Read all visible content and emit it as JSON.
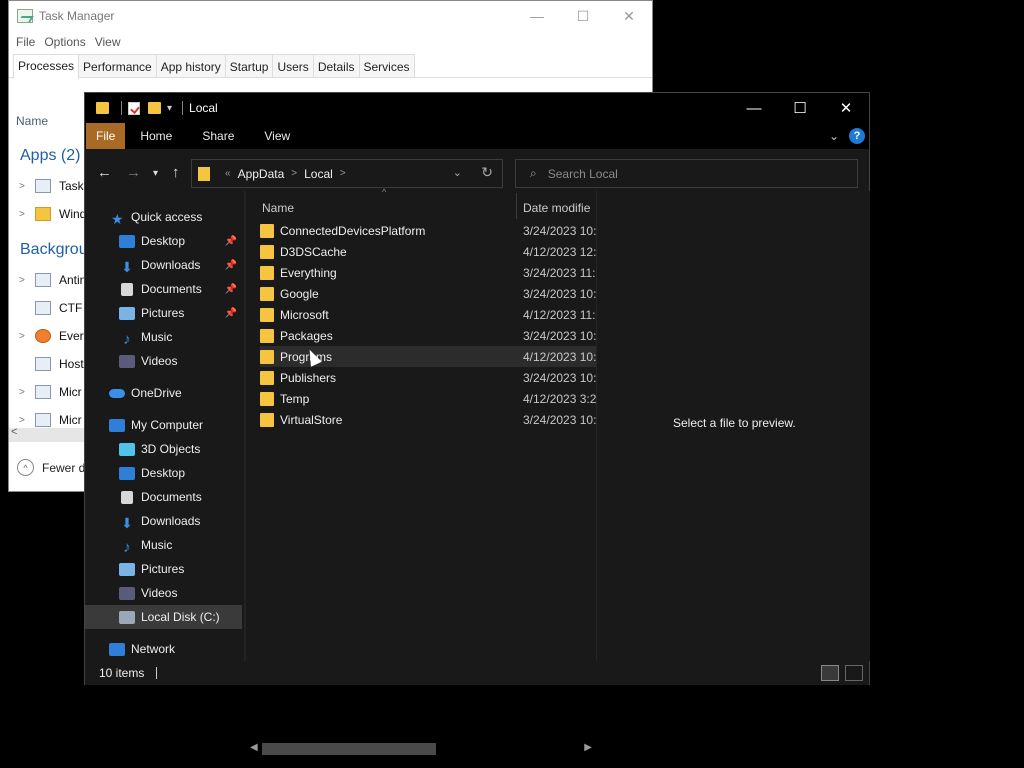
{
  "task_manager": {
    "title": "Task Manager",
    "caption_buttons": [
      "—",
      "☐",
      "✕"
    ],
    "menu": [
      "File",
      "Options",
      "View"
    ],
    "tabs": [
      "Processes",
      "Performance",
      "App history",
      "Startup",
      "Users",
      "Details",
      "Services"
    ],
    "active_tab": "Processes",
    "column_name": "Name",
    "group_apps": "Apps (2)",
    "group_background": "Backgrou",
    "rows": [
      "Task",
      "Wind",
      "Antin",
      "CTF",
      "Every",
      "Host",
      "Micr",
      "Micr"
    ],
    "fewer_details": "Fewer d"
  },
  "explorer": {
    "title": "Local",
    "caption_buttons": [
      "—",
      "☐",
      "✕"
    ],
    "ribbon_tabs": [
      "File",
      "Home",
      "Share",
      "View"
    ],
    "help_label": "?",
    "address": {
      "overflow": "«",
      "segments": [
        "AppData",
        "Local"
      ]
    },
    "search_placeholder": "Search Local",
    "nav_pane": {
      "quick_access": "Quick access",
      "quick_items": [
        "Desktop",
        "Downloads",
        "Documents",
        "Pictures",
        "Music",
        "Videos"
      ],
      "onedrive": "OneDrive",
      "my_computer": "My Computer",
      "computer_items": [
        "3D Objects",
        "Desktop",
        "Documents",
        "Downloads",
        "Music",
        "Pictures",
        "Videos",
        "Local Disk (C:)"
      ],
      "network": "Network",
      "selected": "Local Disk (C:)"
    },
    "columns": {
      "name": "Name",
      "date": "Date modifie"
    },
    "files": [
      {
        "name": "ConnectedDevicesPlatform",
        "date": "3/24/2023 10:"
      },
      {
        "name": "D3DSCache",
        "date": "4/12/2023 12:"
      },
      {
        "name": "Everything",
        "date": "3/24/2023 11:"
      },
      {
        "name": "Google",
        "date": "3/24/2023 10:"
      },
      {
        "name": "Microsoft",
        "date": "4/12/2023 11:"
      },
      {
        "name": "Packages",
        "date": "3/24/2023 10:"
      },
      {
        "name": "Programs",
        "date": "4/12/2023 10:"
      },
      {
        "name": "Publishers",
        "date": "3/24/2023 10:"
      },
      {
        "name": "Temp",
        "date": "4/12/2023 3:2"
      },
      {
        "name": "VirtualStore",
        "date": "3/24/2023 10:"
      }
    ],
    "hovered_file": "Programs",
    "preview_text": "Select a file to preview.",
    "status_text": "10 items"
  },
  "colors": {
    "folder": "#f5c542",
    "file_tab": "#a86a25",
    "help": "#1e7ad6",
    "tm_group": "#1f5fa8"
  }
}
